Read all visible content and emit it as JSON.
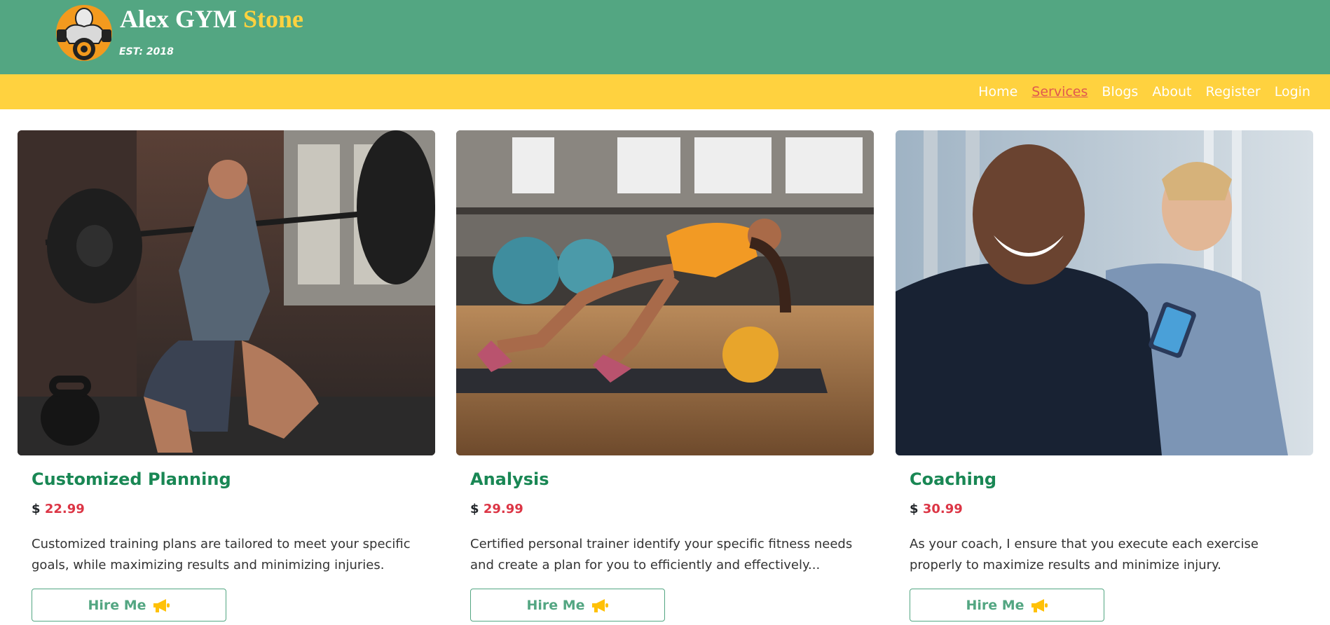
{
  "header": {
    "brand_main": "Alex GYM",
    "brand_accent": "Stone",
    "established": "EST: 2018"
  },
  "nav": {
    "items": [
      {
        "label": "Home",
        "active": false
      },
      {
        "label": "Services",
        "active": true
      },
      {
        "label": "Blogs",
        "active": false
      },
      {
        "label": "About",
        "active": false
      },
      {
        "label": "Register",
        "active": false
      },
      {
        "label": "Login",
        "active": false
      }
    ]
  },
  "colors": {
    "header_bg": "#53a682",
    "nav_bg": "#ffd23f",
    "title": "#198754",
    "price": "#dc3545",
    "active_nav": "#e0584f"
  },
  "services": [
    {
      "title": "Customized Planning",
      "currency": "$",
      "price": "22.99",
      "description": "Customized training plans are tailored to meet your specific goals, while maximizing results and minimizing injuries.",
      "button_label": "Hire Me",
      "button_icon": "megaphone-icon"
    },
    {
      "title": "Analysis",
      "currency": "$",
      "price": "29.99",
      "description": "Certified personal trainer identify your specific fitness needs and create a plan for you to efficiently and effectively...",
      "button_label": "Hire Me",
      "button_icon": "megaphone-icon"
    },
    {
      "title": "Coaching",
      "currency": "$",
      "price": "30.99",
      "description": "As your coach, I ensure that you execute each exercise properly to maximize results and minimize injury.",
      "button_label": "Hire Me",
      "button_icon": "megaphone-icon"
    }
  ]
}
